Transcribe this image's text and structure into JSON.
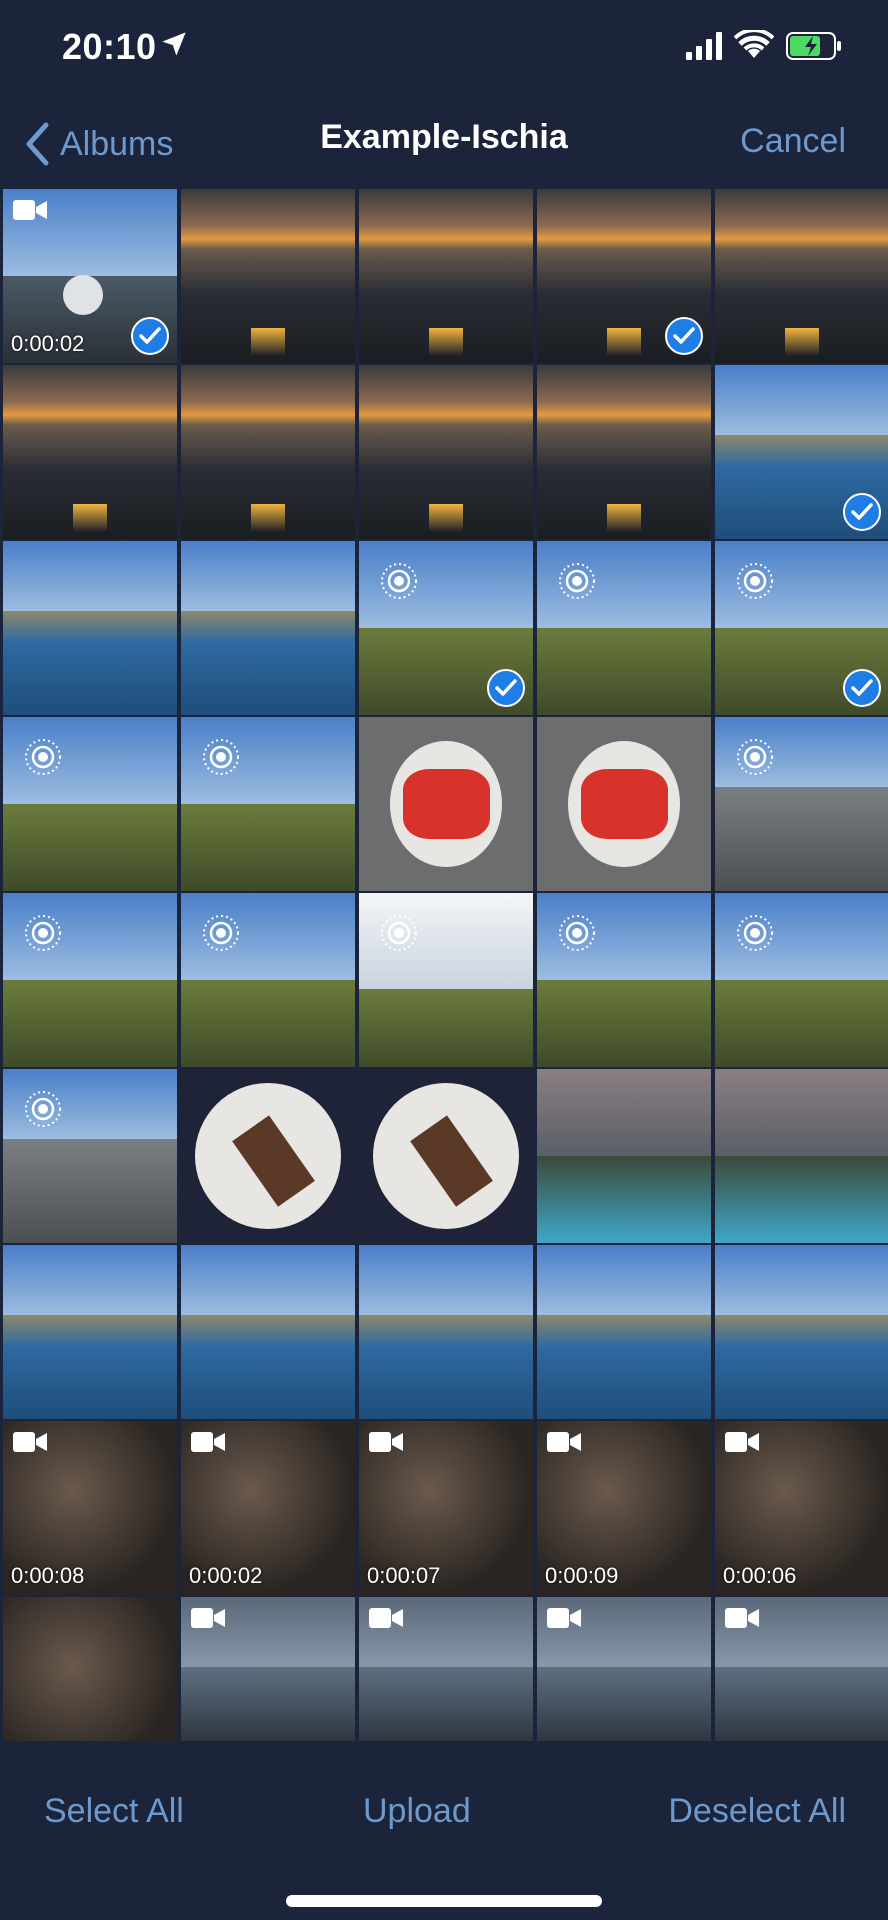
{
  "status": {
    "time": "20:10"
  },
  "nav": {
    "back_label": "Albums",
    "title": "Example-Ischia",
    "cancel_label": "Cancel"
  },
  "toolbar": {
    "select_all": "Select All",
    "upload": "Upload",
    "deselect_all": "Deselect All"
  },
  "colors": {
    "accent": "#6e99cc",
    "background": "#1b243a",
    "check": "#1f7de6"
  },
  "grid": {
    "items": [
      {
        "kind": "video",
        "duration": "0:00:02",
        "selected": true,
        "scene": "boat"
      },
      {
        "kind": "photo",
        "selected": false,
        "scene": "sunset"
      },
      {
        "kind": "photo",
        "selected": false,
        "scene": "sunset"
      },
      {
        "kind": "photo",
        "selected": true,
        "scene": "sunset"
      },
      {
        "kind": "photo",
        "selected": false,
        "scene": "sunset"
      },
      {
        "kind": "photo",
        "selected": false,
        "scene": "sunset"
      },
      {
        "kind": "photo",
        "selected": false,
        "scene": "sunset"
      },
      {
        "kind": "photo",
        "selected": false,
        "scene": "sunset"
      },
      {
        "kind": "photo",
        "selected": false,
        "scene": "sunset"
      },
      {
        "kind": "photo",
        "selected": true,
        "scene": "coast"
      },
      {
        "kind": "photo",
        "selected": false,
        "scene": "coast"
      },
      {
        "kind": "photo",
        "selected": false,
        "scene": "coast"
      },
      {
        "kind": "live",
        "selected": true,
        "scene": "hill"
      },
      {
        "kind": "live",
        "selected": false,
        "scene": "hill"
      },
      {
        "kind": "live",
        "selected": true,
        "scene": "hill"
      },
      {
        "kind": "live",
        "selected": false,
        "scene": "hill"
      },
      {
        "kind": "live",
        "selected": false,
        "scene": "hill"
      },
      {
        "kind": "photo",
        "selected": false,
        "scene": "food"
      },
      {
        "kind": "photo",
        "selected": false,
        "scene": "food"
      },
      {
        "kind": "live",
        "selected": false,
        "scene": "rocks"
      },
      {
        "kind": "live",
        "selected": false,
        "scene": "hill"
      },
      {
        "kind": "live",
        "selected": false,
        "scene": "hill"
      },
      {
        "kind": "live",
        "selected": false,
        "scene": "bright"
      },
      {
        "kind": "live",
        "selected": false,
        "scene": "hill"
      },
      {
        "kind": "live",
        "selected": false,
        "scene": "hill"
      },
      {
        "kind": "live",
        "selected": false,
        "scene": "rocks"
      },
      {
        "kind": "photo",
        "selected": false,
        "scene": "dessert"
      },
      {
        "kind": "photo",
        "selected": false,
        "scene": "dessert"
      },
      {
        "kind": "photo",
        "selected": false,
        "scene": "pool"
      },
      {
        "kind": "photo",
        "selected": false,
        "scene": "pool"
      },
      {
        "kind": "photo",
        "selected": false,
        "scene": "coast"
      },
      {
        "kind": "photo",
        "selected": false,
        "scene": "coast"
      },
      {
        "kind": "photo",
        "selected": false,
        "scene": "coast"
      },
      {
        "kind": "photo",
        "selected": false,
        "scene": "coast"
      },
      {
        "kind": "photo",
        "selected": false,
        "scene": "coast"
      },
      {
        "kind": "video",
        "duration": "0:00:08",
        "selected": false,
        "scene": "stones"
      },
      {
        "kind": "video",
        "duration": "0:00:02",
        "selected": false,
        "scene": "stones"
      },
      {
        "kind": "video",
        "duration": "0:00:07",
        "selected": false,
        "scene": "stones"
      },
      {
        "kind": "video",
        "duration": "0:00:09",
        "selected": false,
        "scene": "stones"
      },
      {
        "kind": "video",
        "duration": "0:00:06",
        "selected": false,
        "scene": "stones"
      },
      {
        "kind": "photo",
        "selected": false,
        "scene": "stones"
      },
      {
        "kind": "video",
        "duration": "",
        "selected": false,
        "scene": "glitter"
      },
      {
        "kind": "video",
        "duration": "",
        "selected": false,
        "scene": "glitter"
      },
      {
        "kind": "video",
        "duration": "",
        "selected": false,
        "scene": "glitter"
      },
      {
        "kind": "video",
        "duration": "",
        "selected": false,
        "scene": "glitter"
      }
    ]
  }
}
